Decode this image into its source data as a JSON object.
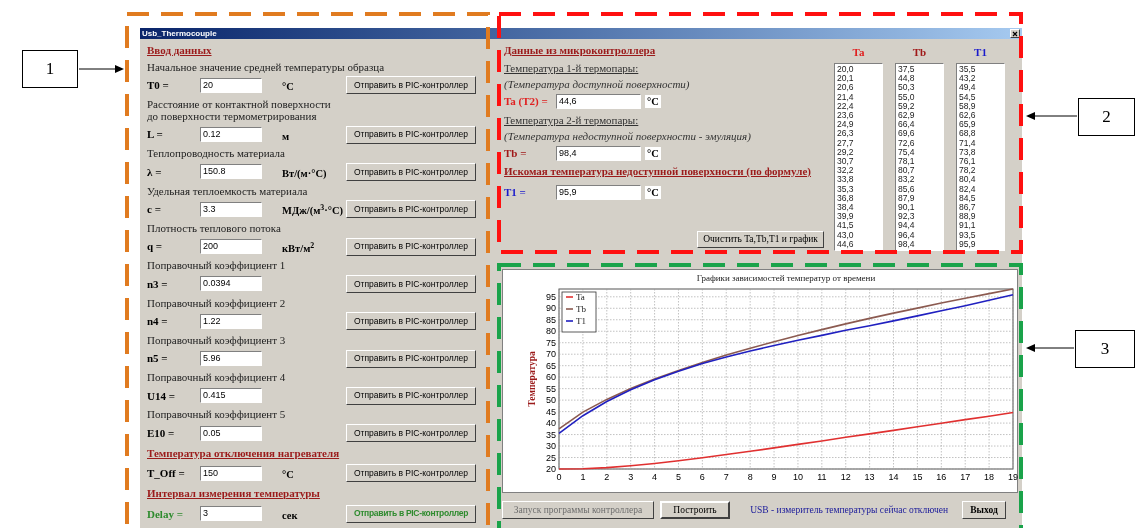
{
  "annotations": [
    {
      "label": "1"
    },
    {
      "label": "2"
    },
    {
      "label": "3"
    }
  ],
  "window": {
    "title": "Usb_Thermocouple"
  },
  "input_panel": {
    "heading": "Ввод данных",
    "items": [
      {
        "kind": "field",
        "description": "Начальное значение средней температуры образца",
        "label": "T0 =",
        "value": "20",
        "unit": "°C",
        "button": "Отправить в PIC-контроллер"
      },
      {
        "kind": "field",
        "description": "Расстояние от контактной поверхности\nдо поверхности термометрирования",
        "label": "L =",
        "value": "0.12",
        "unit": "м",
        "button": "Отправить в PIC-контроллер"
      },
      {
        "kind": "field",
        "description": "Теплопроводность материала",
        "label": "λ =",
        "value": "150.8",
        "unit": "Вт/(м·°С)",
        "button": "Отправить в PIC-контроллер"
      },
      {
        "kind": "field",
        "description": "Удельная теплоемкость материала",
        "label": "c =",
        "value": "3.3",
        "unit": "МДж/(м$^{3}$·°С)",
        "button": "Отправить в PIC-контроллер"
      },
      {
        "kind": "field",
        "description": "Плотность теплового потока",
        "label": "q =",
        "value": "200",
        "unit": "кВт/м$^{2}$",
        "button": "Отправить в PIC-контроллер"
      },
      {
        "kind": "field",
        "description": "Поправочный коэффициент 1",
        "label": "n3 =",
        "value": "0.0394",
        "button": "Отправить в PIC-контроллер"
      },
      {
        "kind": "field",
        "description": "Поправочный коэффициент 2",
        "label": "n4 =",
        "value": "1.22",
        "button": "Отправить в PIC-контроллер"
      },
      {
        "kind": "field",
        "description": "Поправочный коэффициент 3",
        "label": "n5 =",
        "value": "5.96",
        "button": "Отправить в PIC-контроллер"
      },
      {
        "kind": "field",
        "description": "Поправочный коэффициент 4",
        "label": "U14 =",
        "value": "0.415",
        "button": "Отправить в PIC-контроллер"
      },
      {
        "kind": "field",
        "description": "Поправочный коэффициент 5",
        "label": "E10 =",
        "value": "0.05",
        "button": "Отправить в PIC-контроллер"
      },
      {
        "kind": "heading",
        "text": "Температура отключения нагревателя"
      },
      {
        "kind": "field",
        "label": "T_Off =",
        "value": "150",
        "unit": "°C",
        "button": "Отправить в PIC-контроллер"
      },
      {
        "kind": "heading",
        "text": "Интервал измерения температуры"
      },
      {
        "kind": "field",
        "label": "Delay =",
        "value": "3",
        "unit": "сек",
        "button": "Отправить в PIC-контроллер",
        "color": "#2e8b2e"
      }
    ]
  },
  "readings_panel": {
    "heading": "Данные из микроконтроллера",
    "groups": [
      {
        "title": "Температура 1-й термопары:",
        "note": "(Температура доступной поверхности)",
        "label": "Ta (T2) =",
        "value": "44,6",
        "unit": "°C",
        "color": "#e02020"
      },
      {
        "title": "Температура 2-й термопары:",
        "note": "(Температура недоступной поверхности - эмуляция)",
        "label": "Tb =",
        "value": "98,4",
        "unit": "°C",
        "color": "#a01818"
      },
      {
        "heading": "Искомая температура недоступной поверхности (по формуле)",
        "label": "T1 =",
        "value": "95,9",
        "unit": "°C",
        "color": "#1a1acc"
      }
    ],
    "clear_button": "Очистить Ta,Tb,T1 и график"
  },
  "lists": [
    {
      "header": "Ta",
      "color": "#e02020",
      "values": [
        "20,0",
        "20,1",
        "20,6",
        "21,4",
        "22,4",
        "23,6",
        "24,9",
        "26,3",
        "27,7",
        "29,2",
        "30,7",
        "32,2",
        "33,8",
        "35,3",
        "36,8",
        "38,4",
        "39,9",
        "41,5",
        "43,0",
        "44,6"
      ]
    },
    {
      "header": "Tb",
      "color": "#a01818",
      "values": [
        "37,5",
        "44,8",
        "50,3",
        "55,0",
        "59,2",
        "62,9",
        "66,4",
        "69,6",
        "72,6",
        "75,4",
        "78,1",
        "80,7",
        "83,2",
        "85,6",
        "87,9",
        "90,1",
        "92,3",
        "94,4",
        "96,4",
        "98,4"
      ]
    },
    {
      "header": "T1",
      "color": "#1a1acc",
      "values": [
        "35,5",
        "43,2",
        "49,4",
        "54,5",
        "58,9",
        "62,6",
        "65,9",
        "68,8",
        "71,4",
        "73,8",
        "76,1",
        "78,2",
        "80,4",
        "82,4",
        "84,5",
        "86,7",
        "88,9",
        "91,1",
        "93,5",
        "95,9"
      ]
    }
  ],
  "chart_panel": {
    "chart_data": {
      "type": "line",
      "title": "Графики зависимостей температур от времени",
      "ylabel": "Температура",
      "x": [
        0,
        1,
        2,
        3,
        4,
        5,
        6,
        7,
        8,
        9,
        10,
        11,
        12,
        13,
        14,
        15,
        16,
        17,
        18,
        19
      ],
      "series": [
        {
          "name": "Ta",
          "color": "#e03030",
          "values": [
            20.0,
            20.1,
            20.6,
            21.4,
            22.4,
            23.6,
            24.9,
            26.3,
            27.7,
            29.2,
            30.7,
            32.2,
            33.8,
            35.3,
            36.8,
            38.4,
            39.9,
            41.5,
            43.0,
            44.6
          ]
        },
        {
          "name": "Tb",
          "color": "#8b5a50",
          "values": [
            37.5,
            44.8,
            50.3,
            55.0,
            59.2,
            62.9,
            66.4,
            69.6,
            72.6,
            75.4,
            78.1,
            80.7,
            83.2,
            85.6,
            87.9,
            90.1,
            92.3,
            94.4,
            96.4,
            98.4
          ]
        },
        {
          "name": "T1",
          "color": "#2020c0",
          "values": [
            35.5,
            43.2,
            49.4,
            54.5,
            58.9,
            62.6,
            65.9,
            68.8,
            71.4,
            73.8,
            76.1,
            78.2,
            80.4,
            82.4,
            84.5,
            86.7,
            88.9,
            91.1,
            93.5,
            95.9
          ]
        }
      ],
      "grid": true,
      "legend": true,
      "xlim": [
        0,
        19
      ],
      "ylim": [
        20,
        98.4
      ],
      "xticks": [
        0,
        1,
        2,
        3,
        4,
        5,
        6,
        7,
        8,
        9,
        10,
        11,
        12,
        13,
        14,
        15,
        16,
        17,
        18,
        19
      ],
      "yticks": [
        20,
        25,
        30,
        35,
        40,
        45,
        50,
        55,
        60,
        65,
        70,
        75,
        80,
        85,
        90,
        95
      ]
    },
    "buttons": [
      {
        "label": "Запуск программы контроллера",
        "disabled": true
      },
      {
        "label": "Построить",
        "disabled": false
      }
    ],
    "status": "USB - измеритель температуры сейчас отключен",
    "exit_button": "Выход"
  }
}
